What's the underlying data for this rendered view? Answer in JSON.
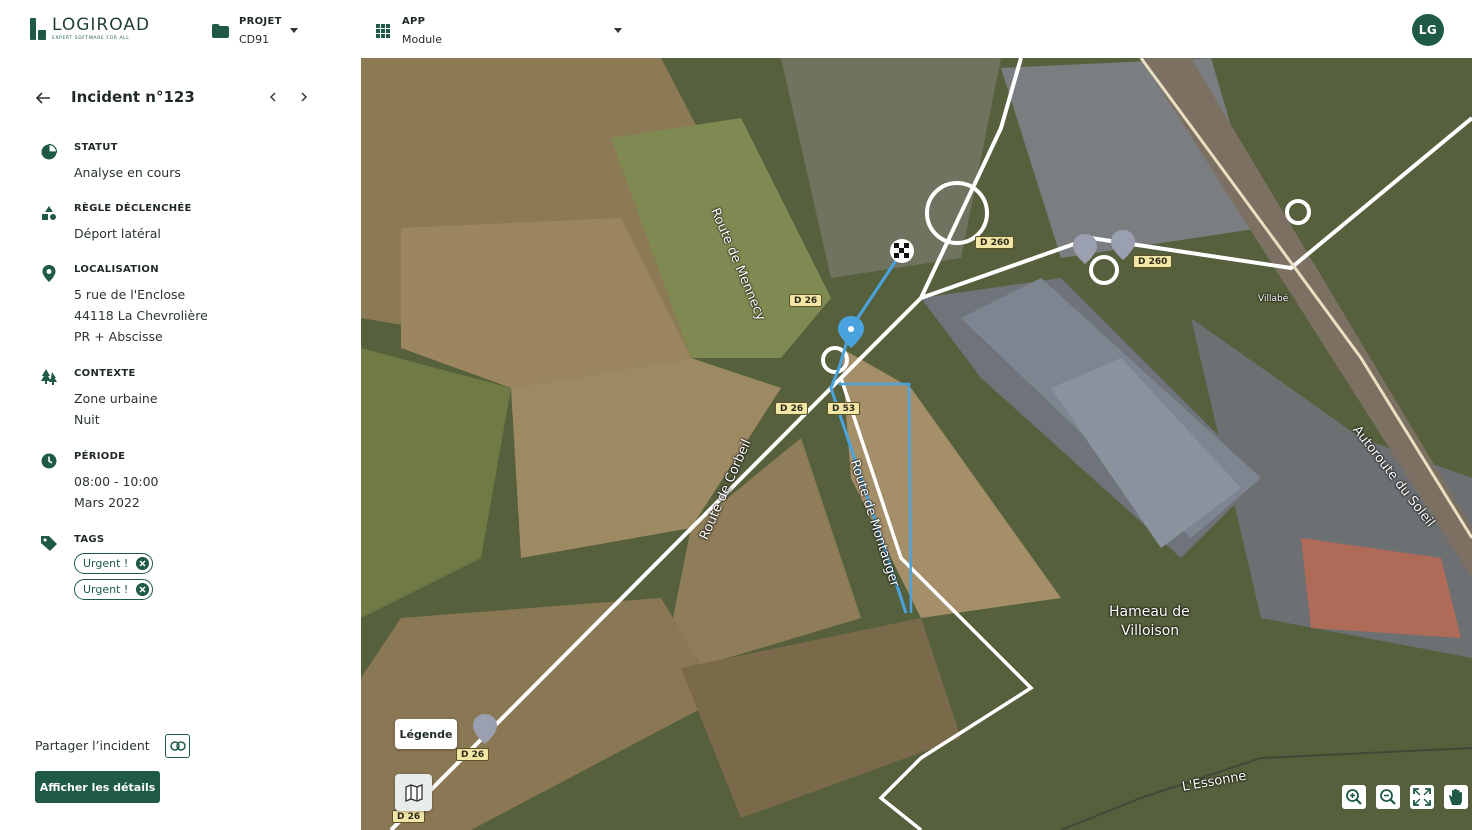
{
  "header": {
    "logo_title": "LOGIROAD",
    "logo_subtitle": "EXPERT SOFTWARE FOR ALL",
    "project_label": "PROJET",
    "project_value": "CD91",
    "app_label": "APP",
    "app_value": "Module",
    "user_initials": "LG"
  },
  "incident": {
    "title": "Incident n°123",
    "status_label": "STATUT",
    "status_value": "Analyse en cours",
    "rule_label": "RÈGLE DÉCLENCHÉE",
    "rule_value": "Déport latéral",
    "location_label": "LOCALISATION",
    "location_lines": [
      "5 rue de l'Enclose",
      "44118 La Chevrolière",
      "PR + Abscisse"
    ],
    "context_label": "CONTEXTE",
    "context_lines": [
      "Zone urbaine",
      "Nuit"
    ],
    "period_label": "PÉRIODE",
    "period_lines": [
      "08:00 - 10:00",
      "Mars 2022"
    ],
    "tags_label": "TAGS",
    "tags": [
      "Urgent !",
      "Urgent !"
    ],
    "share_label": "Partager l’incident",
    "details_button": "Afficher les détails"
  },
  "map": {
    "legend_button": "Légende",
    "road_labels": [
      "D 260",
      "D 260",
      "D 26",
      "D 26",
      "D 53",
      "D 26",
      "D 26"
    ],
    "place_labels": [
      "Route de Mennecy",
      "Route de Corbeil",
      "Route de Montauger",
      "Autoroute du Soleil",
      "Hameau de",
      "Villoison",
      "L'Essonne",
      "Villabé"
    ],
    "colors": {
      "route": "#4aa3df",
      "brand": "#1e5a46"
    },
    "tools": [
      "zoom-in-icon",
      "zoom-out-icon",
      "fullscreen-icon",
      "hand-icon"
    ]
  }
}
